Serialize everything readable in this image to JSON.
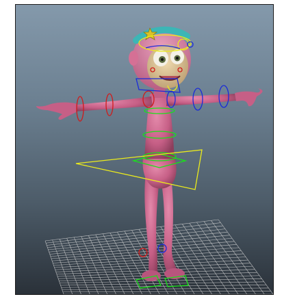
{
  "viewport": {
    "label": "",
    "colors": {
      "background_top": "#8499ab",
      "background_bottom": "#2a3139",
      "character_skin": "#c65f86",
      "grid": "#d8d8d8",
      "control_red": "#d11a1a",
      "control_blue": "#1a2bd8",
      "control_green": "#19e219",
      "control_yellow": "#ecec1c"
    },
    "objects": [
      {
        "name": "ground-grid",
        "type": "grid"
      },
      {
        "name": "character",
        "type": "mesh"
      },
      {
        "name": "hips-control",
        "type": "triangle-control"
      },
      {
        "name": "spine-controls",
        "type": "ring-controls"
      },
      {
        "name": "arm-fk-controls",
        "type": "ring-controls"
      },
      {
        "name": "head-control",
        "type": "circle-control"
      },
      {
        "name": "foot-ik-controls",
        "type": "foot-controls"
      }
    ]
  }
}
